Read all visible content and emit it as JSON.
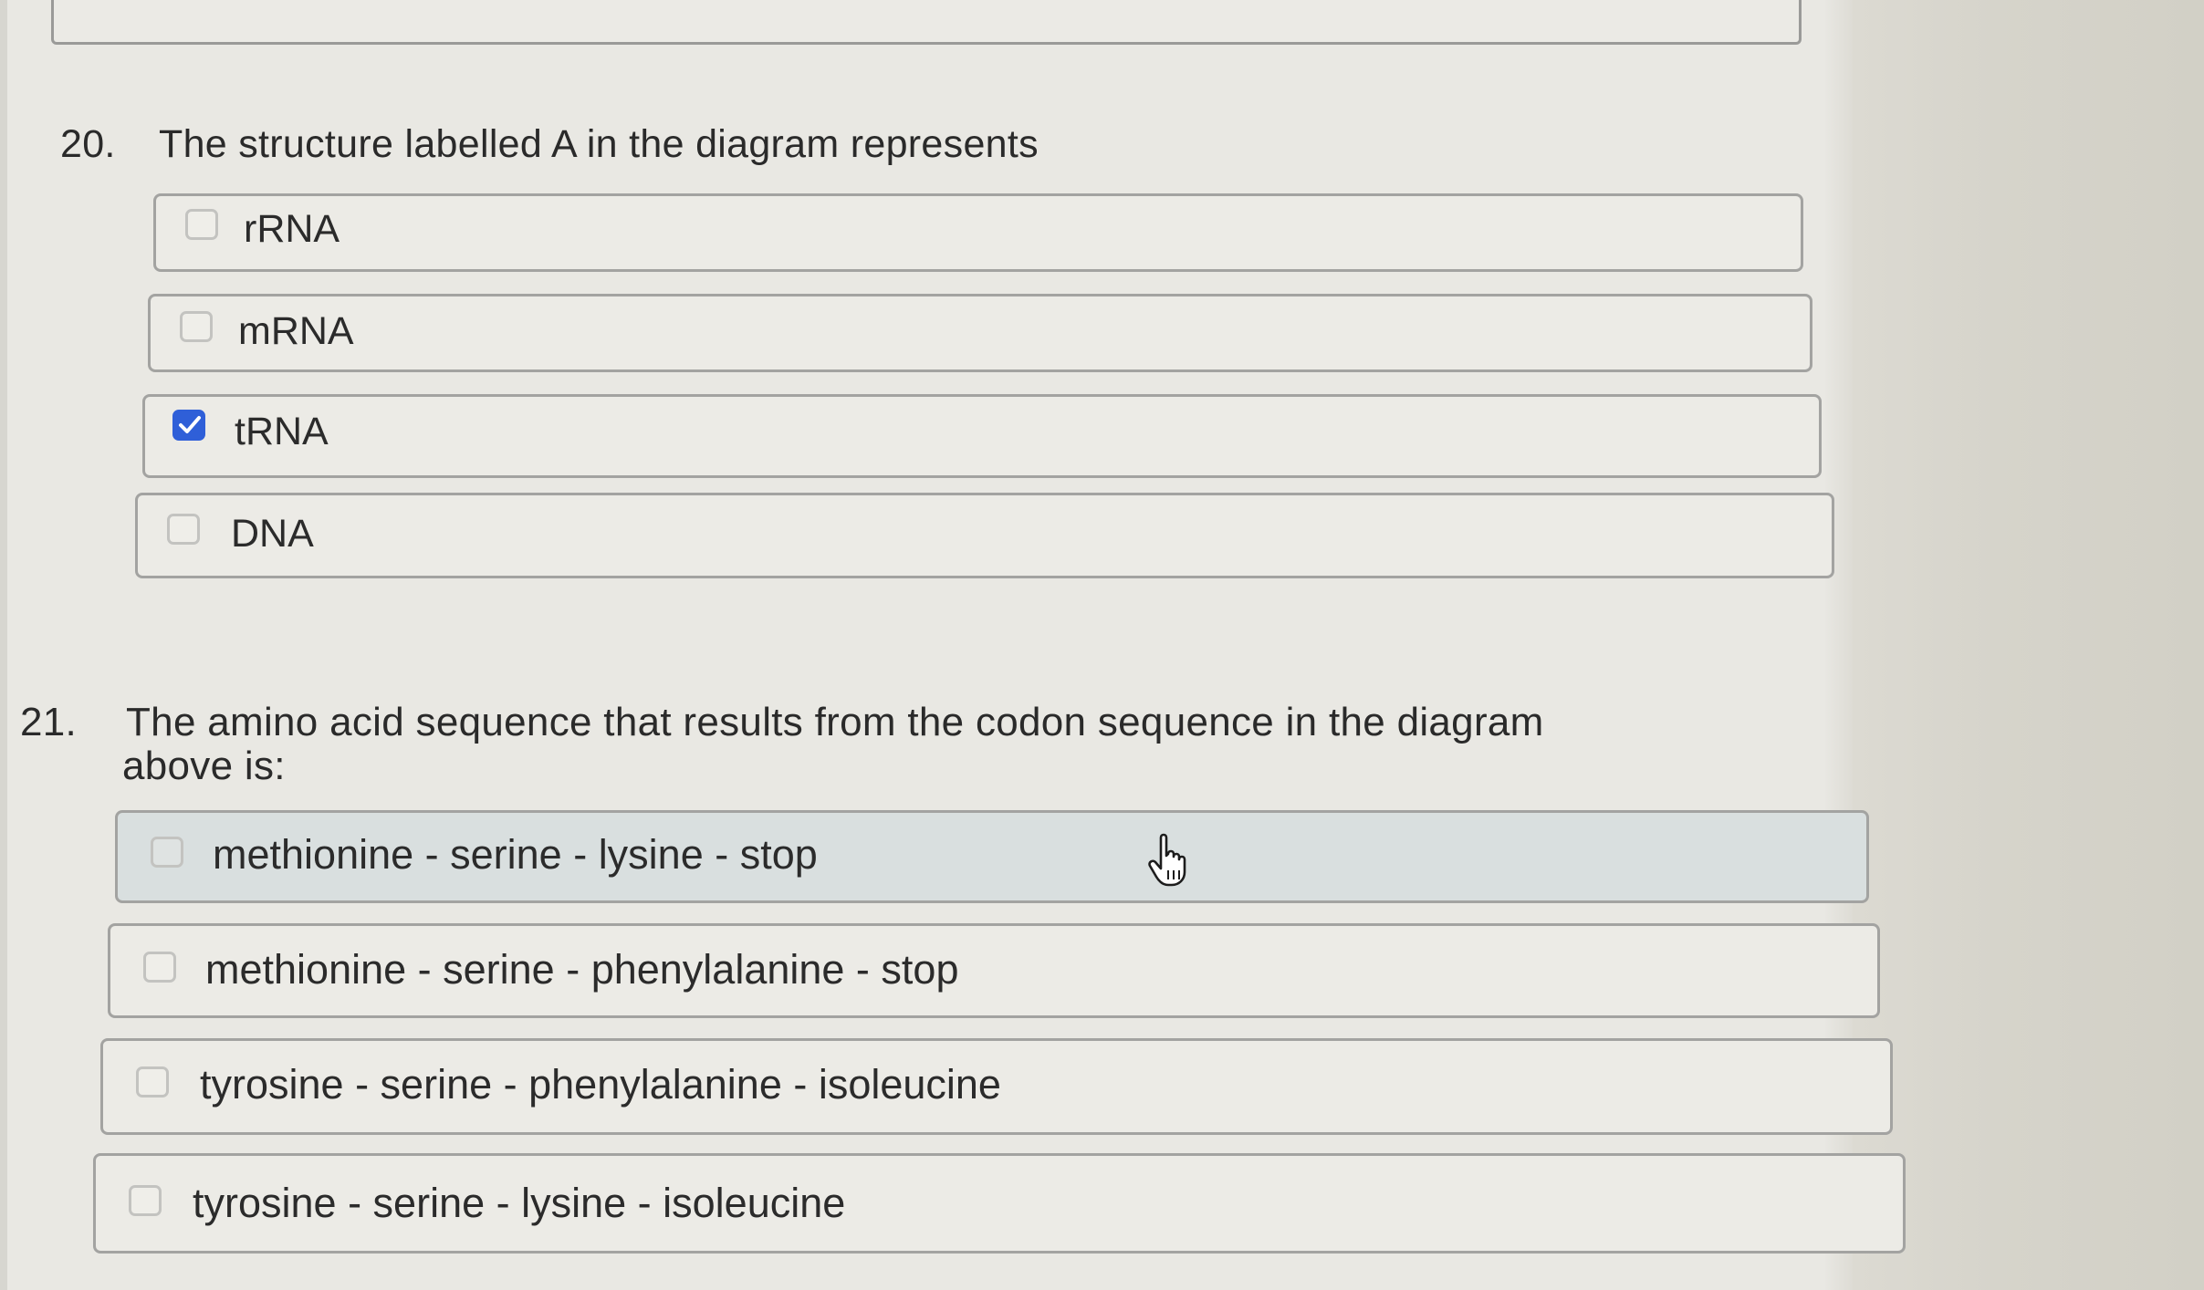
{
  "questions": [
    {
      "number": "20.",
      "text": "The structure labelled A in the diagram represents",
      "options": [
        {
          "label": "rRNA",
          "checked": false
        },
        {
          "label": "mRNA",
          "checked": false
        },
        {
          "label": "tRNA",
          "checked": true
        },
        {
          "label": "DNA",
          "checked": false
        }
      ]
    },
    {
      "number": "21.",
      "text_line1": "The amino acid sequence that results from the codon sequence in the diagram",
      "text_line2": "above is:",
      "options": [
        {
          "label": "methionine - serine - lysine - stop",
          "checked": false,
          "hovered": true
        },
        {
          "label": "methionine - serine - phenylalanine - stop",
          "checked": false
        },
        {
          "label": "tyrosine - serine - phenylalanine - isoleucine",
          "checked": false
        },
        {
          "label": "tyrosine - serine - lysine - isoleucine",
          "checked": false
        }
      ]
    }
  ],
  "colors": {
    "checkbox_checked": "#2f5fd8",
    "option_border": "#a3a3a1",
    "option_hover_bg": "#d9dfdf"
  },
  "icons": {
    "checked": "checkmark-icon",
    "cursor": "hand-pointer-cursor-icon"
  }
}
